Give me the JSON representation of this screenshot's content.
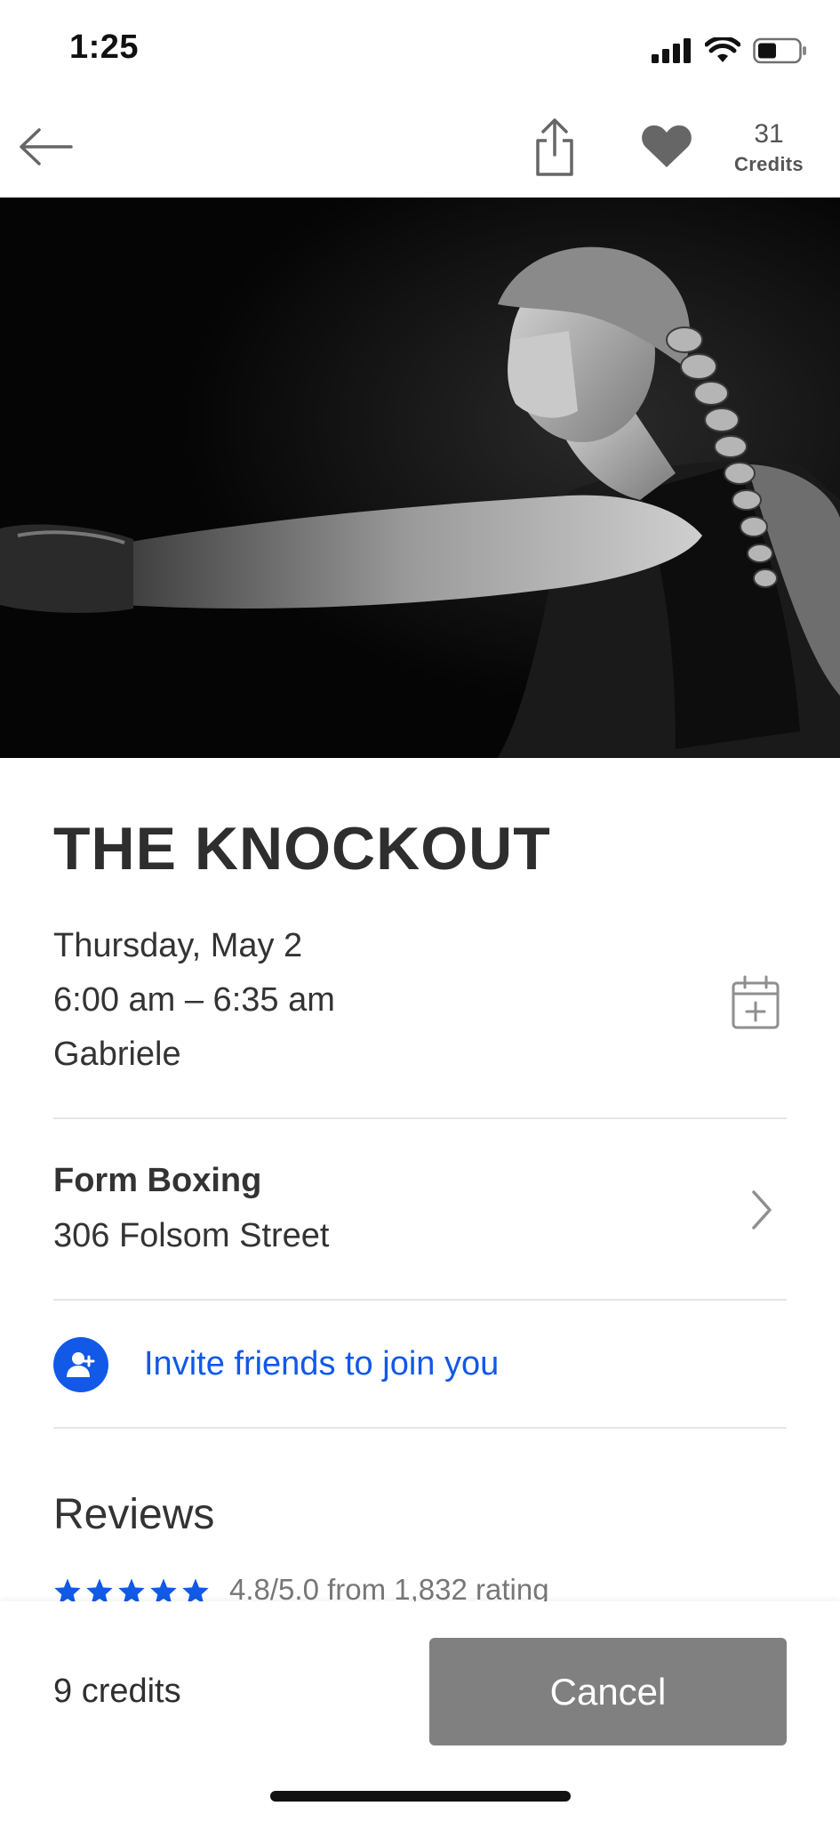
{
  "status_bar": {
    "time": "1:25"
  },
  "header": {
    "credits_count": "31",
    "credits_label": "Credits"
  },
  "class": {
    "title": "THE KNOCKOUT",
    "date": "Thursday, May 2",
    "time_range": "6:00 am – 6:35 am",
    "instructor": "Gabriele"
  },
  "studio": {
    "name": "Form Boxing",
    "address": "306 Folsom Street"
  },
  "invite": {
    "label": "Invite friends to join you"
  },
  "reviews": {
    "title": "Reviews",
    "rating_text": "4.8/5.0 from 1,832 rating",
    "stars": 5
  },
  "footer": {
    "price": "9 credits",
    "cancel_label": "Cancel"
  },
  "colors": {
    "accent": "#1159e6",
    "cancel_bg": "#808080"
  }
}
